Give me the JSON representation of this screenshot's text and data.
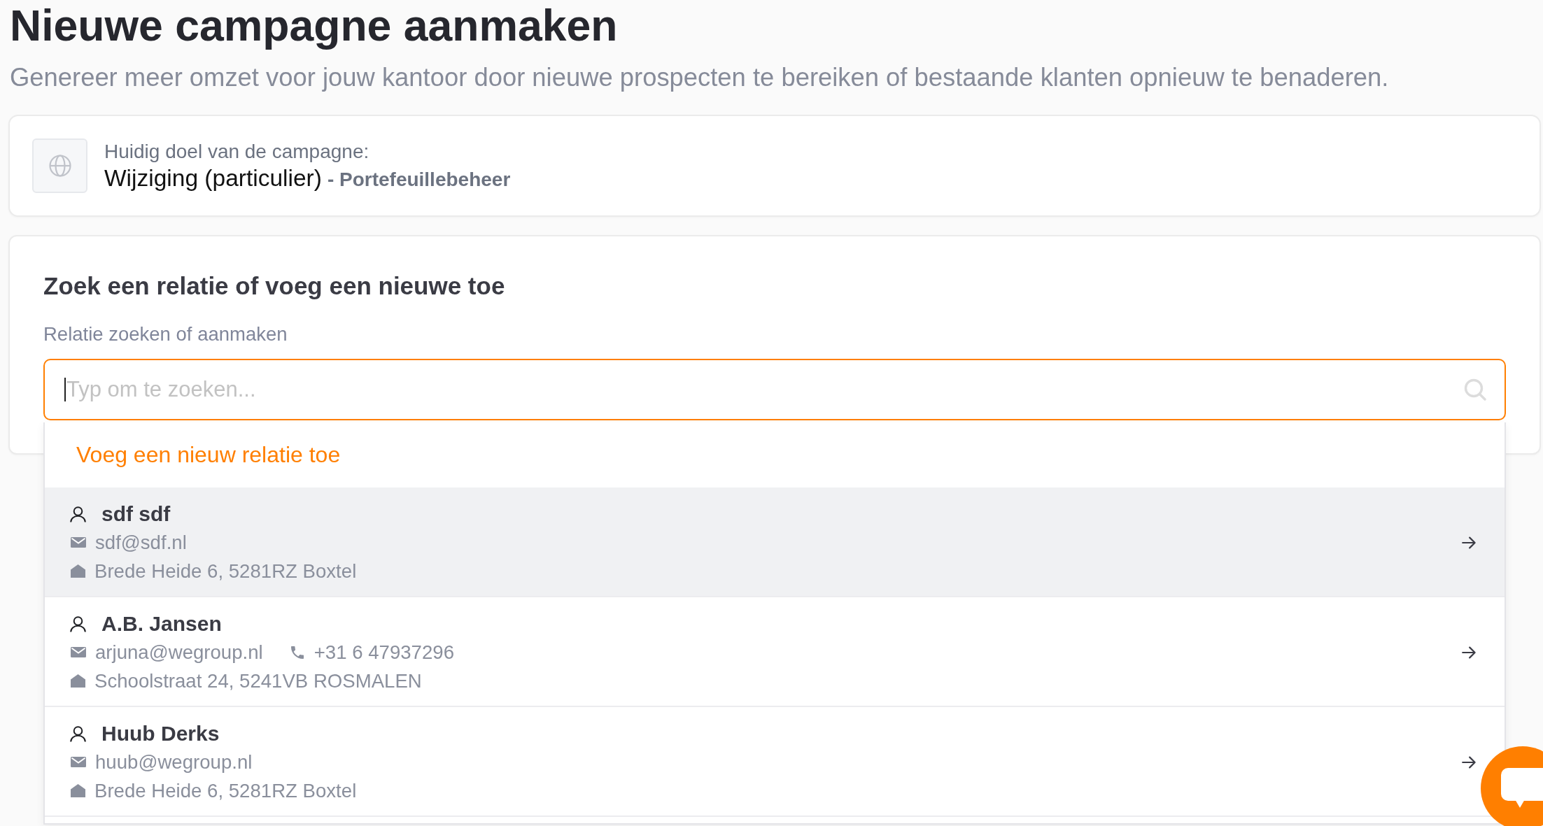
{
  "page": {
    "title": "Nieuwe campagne aanmaken",
    "subtitle": "Genereer meer omzet voor jouw kantoor door nieuwe prospecten te bereiken of bestaande klanten opnieuw te benaderen."
  },
  "goal_card": {
    "label": "Huidig doel van de campagne:",
    "goal": "Wijziging (particulier)",
    "category": "- Portefeuillebeheer"
  },
  "search_card": {
    "heading": "Zoek een relatie of voeg een nieuwe toe",
    "field_label": "Relatie zoeken of aanmaken",
    "search": {
      "placeholder": "Typ om te zoeken...",
      "focused": true
    }
  },
  "dropdown": {
    "add_option": "Voeg een nieuw relatie toe",
    "results": [
      {
        "name": "sdf sdf",
        "email": "sdf@sdf.nl",
        "address": "Brede Heide 6, 5281RZ Boxtel",
        "selected": true
      },
      {
        "name": "A.B. Jansen",
        "email": "arjuna@wegroup.nl",
        "phone": "+31 6 47937296",
        "address": "Schoolstraat 24, 5241VB ROSMALEN",
        "selected": false
      },
      {
        "name": "Huub Derks",
        "email": "huub@wegroup.nl",
        "address": "Brede Heide 6, 5281RZ Boxtel",
        "selected": false
      }
    ]
  }
}
